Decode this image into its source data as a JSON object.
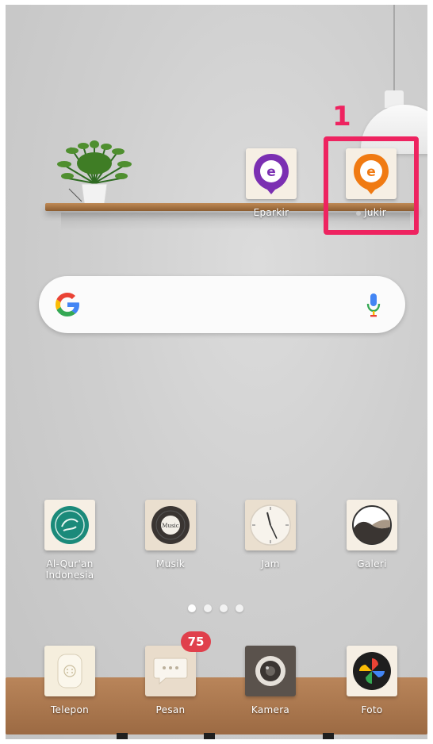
{
  "shelf_apps": [
    {
      "label": "Eparkir",
      "icon": "eparkir-app-icon",
      "color": "#7b2fb2"
    },
    {
      "label": "Jukir",
      "icon": "jukir-app-icon",
      "color": "#f07a12"
    }
  ],
  "annotation": {
    "step": "1",
    "color": "#ee2360"
  },
  "search": {
    "logo": "google-g-icon",
    "mic": "microphone-icon"
  },
  "apps": [
    {
      "label": "Al-Qur'an\nIndonesia",
      "icon": "quran-icon"
    },
    {
      "label": "Musik",
      "icon": "music-icon",
      "icon_text": "Music"
    },
    {
      "label": "Jam",
      "icon": "clock-icon"
    },
    {
      "label": "Galeri",
      "icon": "gallery-icon"
    }
  ],
  "dock": [
    {
      "label": "Telepon",
      "icon": "phone-icon"
    },
    {
      "label": "Pesan",
      "icon": "message-icon",
      "badge": "75"
    },
    {
      "label": "Kamera",
      "icon": "camera-icon"
    },
    {
      "label": "Foto",
      "icon": "photos-icon"
    }
  ]
}
